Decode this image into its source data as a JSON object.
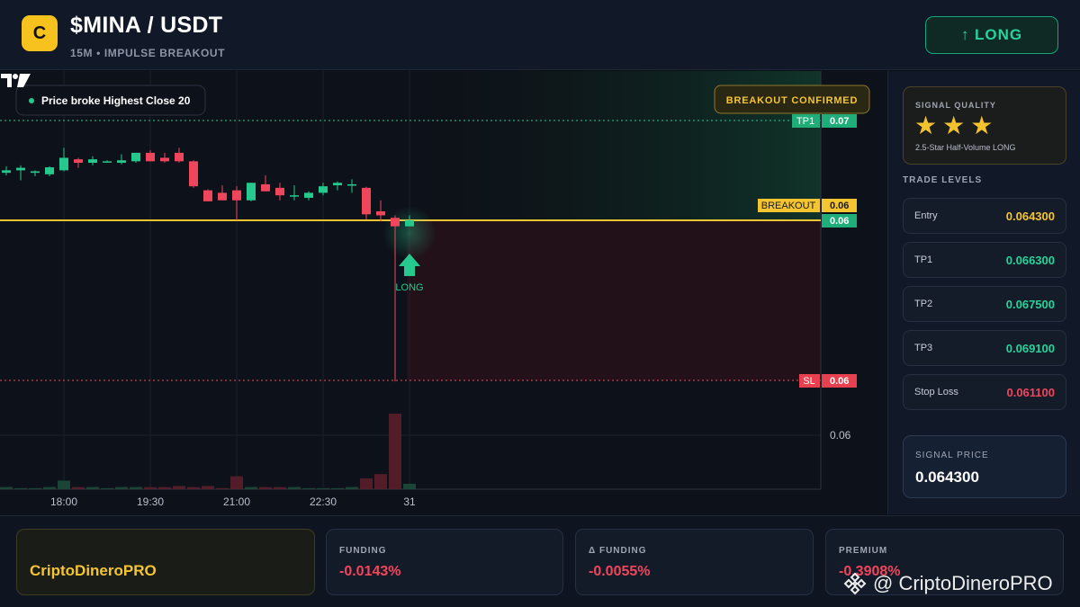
{
  "header": {
    "logo_letter": "C",
    "pair": "$MINA / USDT",
    "subtitle": "15M • IMPULSE BREAKOUT",
    "signal_button": "↑ LONG"
  },
  "chart": {
    "info_badge": "Price broke Highest Close 20",
    "breakout_badge": "BREAKOUT CONFIRMED",
    "long_marker_label": "LONG",
    "price_tags": {
      "tp1_label": "TP1",
      "tp1_value": "0.07",
      "breakout_label": "BREAKOUT",
      "breakout_value": "0.06",
      "current_value": "0.06",
      "sl_label": "SL",
      "sl_value": "0.06",
      "axis_value": "0.06"
    },
    "x_ticks": [
      "18:00",
      "19:30",
      "21:00",
      "22:30",
      "31"
    ],
    "colors": {
      "up": "#26c98d",
      "down": "#f0465c",
      "breakout": "#f5c531",
      "tp": "#26c98d",
      "sl": "#f0465c"
    }
  },
  "chart_data": {
    "type": "candlestick",
    "title": "$MINA / USDT",
    "timeframe": "15M",
    "x_ticks": [
      "18:00",
      "19:30",
      "21:00",
      "22:30",
      "31"
    ],
    "levels": {
      "entry": 0.0643,
      "tp1": 0.0663,
      "tp2": 0.0675,
      "tp3": 0.0691,
      "stop_loss": 0.0611,
      "breakout": 0.0643
    },
    "candles": [
      {
        "o": 0.06525,
        "h": 0.06538,
        "l": 0.0652,
        "c": 0.0653
      },
      {
        "o": 0.0653,
        "h": 0.0654,
        "l": 0.0651,
        "c": 0.06535
      },
      {
        "o": 0.06525,
        "h": 0.0653,
        "l": 0.06518,
        "c": 0.06528
      },
      {
        "o": 0.06522,
        "h": 0.06538,
        "l": 0.06518,
        "c": 0.06536
      },
      {
        "o": 0.0653,
        "h": 0.06575,
        "l": 0.06528,
        "c": 0.06555
      },
      {
        "o": 0.06552,
        "h": 0.06555,
        "l": 0.06535,
        "c": 0.06545
      },
      {
        "o": 0.06545,
        "h": 0.06558,
        "l": 0.0654,
        "c": 0.06552
      },
      {
        "o": 0.06548,
        "h": 0.0655,
        "l": 0.06545,
        "c": 0.06548
      },
      {
        "o": 0.06545,
        "h": 0.06562,
        "l": 0.06542,
        "c": 0.0655
      },
      {
        "o": 0.06548,
        "h": 0.06565,
        "l": 0.06545,
        "c": 0.06565
      },
      {
        "o": 0.06565,
        "h": 0.0657,
        "l": 0.06548,
        "c": 0.06548
      },
      {
        "o": 0.06555,
        "h": 0.06565,
        "l": 0.06545,
        "c": 0.06548
      },
      {
        "o": 0.06565,
        "h": 0.06575,
        "l": 0.06545,
        "c": 0.06548
      },
      {
        "o": 0.06548,
        "h": 0.0655,
        "l": 0.06495,
        "c": 0.06498
      },
      {
        "o": 0.0649,
        "h": 0.06492,
        "l": 0.06468,
        "c": 0.06468
      },
      {
        "o": 0.06485,
        "h": 0.065,
        "l": 0.0647,
        "c": 0.0647
      },
      {
        "o": 0.0649,
        "h": 0.06498,
        "l": 0.0643,
        "c": 0.0647
      },
      {
        "o": 0.0647,
        "h": 0.06505,
        "l": 0.06468,
        "c": 0.06505
      },
      {
        "o": 0.06502,
        "h": 0.0652,
        "l": 0.06488,
        "c": 0.06488
      },
      {
        "o": 0.06495,
        "h": 0.06505,
        "l": 0.0647,
        "c": 0.0648
      },
      {
        "o": 0.0648,
        "h": 0.065,
        "l": 0.0647,
        "c": 0.0648
      },
      {
        "o": 0.06475,
        "h": 0.06488,
        "l": 0.0647,
        "c": 0.06485
      },
      {
        "o": 0.06485,
        "h": 0.06505,
        "l": 0.0648,
        "c": 0.06498
      },
      {
        "o": 0.065,
        "h": 0.06508,
        "l": 0.0649,
        "c": 0.06505
      },
      {
        "o": 0.06502,
        "h": 0.06512,
        "l": 0.06485,
        "c": 0.06502
      },
      {
        "o": 0.06495,
        "h": 0.06497,
        "l": 0.06432,
        "c": 0.06442
      },
      {
        "o": 0.06448,
        "h": 0.0647,
        "l": 0.06428,
        "c": 0.0644
      },
      {
        "o": 0.06435,
        "h": 0.0644,
        "l": 0.06108,
        "c": 0.06418
      },
      {
        "o": 0.06418,
        "h": 0.0644,
        "l": 0.06418,
        "c": 0.0643
      }
    ],
    "volumes": [
      2,
      1,
      1,
      2,
      8,
      2,
      2,
      1,
      2,
      2,
      2,
      2,
      3,
      2,
      3,
      1,
      12,
      2,
      2,
      2,
      2,
      1,
      1,
      1,
      2,
      10,
      14,
      70,
      5
    ]
  },
  "panel": {
    "quality_title": "SIGNAL QUALITY",
    "stars": [
      "★",
      "★",
      "★"
    ],
    "quality_desc": "2.5-Star Half-Volume LONG",
    "levels_title": "TRADE LEVELS",
    "levels": [
      {
        "label": "Entry",
        "value": "0.064300",
        "color": "#f5c531"
      },
      {
        "label": "TP1",
        "value": "0.066300",
        "color": "#26d39a"
      },
      {
        "label": "TP2",
        "value": "0.067500",
        "color": "#26d39a"
      },
      {
        "label": "TP3",
        "value": "0.069100",
        "color": "#26d39a"
      },
      {
        "label": "Stop Loss",
        "value": "0.061100",
        "color": "#f0465c"
      }
    ],
    "signal_price_title": "SIGNAL PRICE",
    "signal_price": "0.064300"
  },
  "footer": {
    "brand": "CriptoDineroPRO",
    "stats": [
      {
        "label": "FUNDING",
        "value": "-0.0143%"
      },
      {
        "label": "Δ FUNDING",
        "value": "-0.0055%"
      },
      {
        "label": "PREMIUM",
        "value": "-0.3908%"
      }
    ],
    "watermark": "@ CriptoDineroPRO"
  }
}
